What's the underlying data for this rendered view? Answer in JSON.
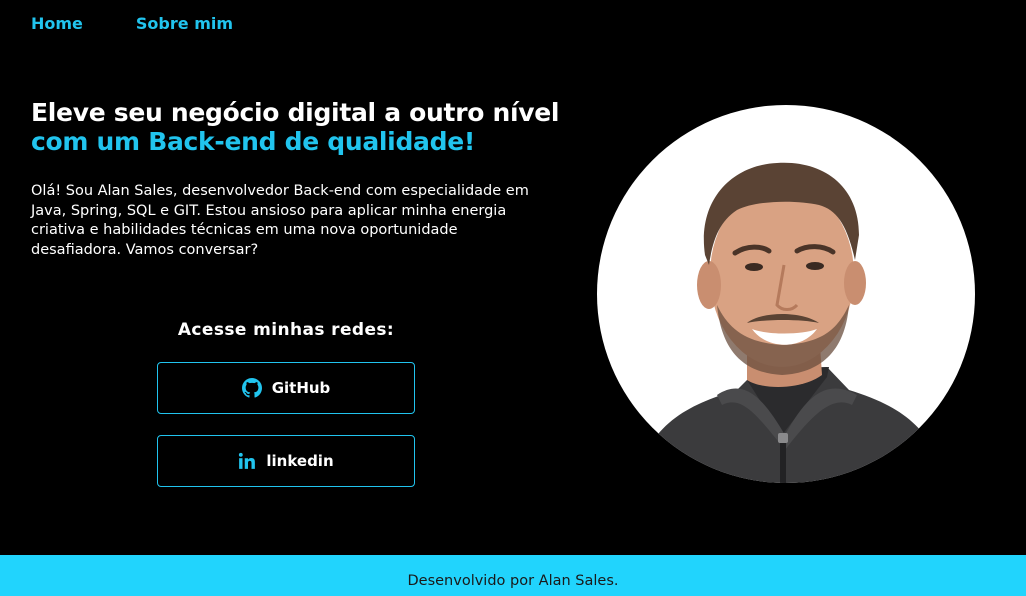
{
  "nav": {
    "home_label": "Home",
    "about_label": "Sobre mim"
  },
  "hero": {
    "headline_white": "Eleve seu negócio digital a outro nível ",
    "headline_accent": "com um Back-end de qualidade!",
    "intro": "Olá! Sou Alan Sales, desenvolvedor Back-end com especialidade em Java, Spring, SQL e GIT. Estou ansioso para aplicar minha energia criativa e habilidades técnicas em uma nova oportunidade desafiadora. Vamos conversar?"
  },
  "social": {
    "title": "Acesse minhas redes:",
    "buttons": [
      {
        "label": "GitHub",
        "icon": "github-icon"
      },
      {
        "label": "linkedin",
        "icon": "linkedin-icon"
      }
    ]
  },
  "profile": {
    "photo": "profile-photo"
  },
  "footer": {
    "text": "Desenvolvido por Alan Sales."
  },
  "colors": {
    "background": "#000000",
    "accent": "#21c4ee",
    "footer": "#21d4fd",
    "text": "#ffffff"
  }
}
